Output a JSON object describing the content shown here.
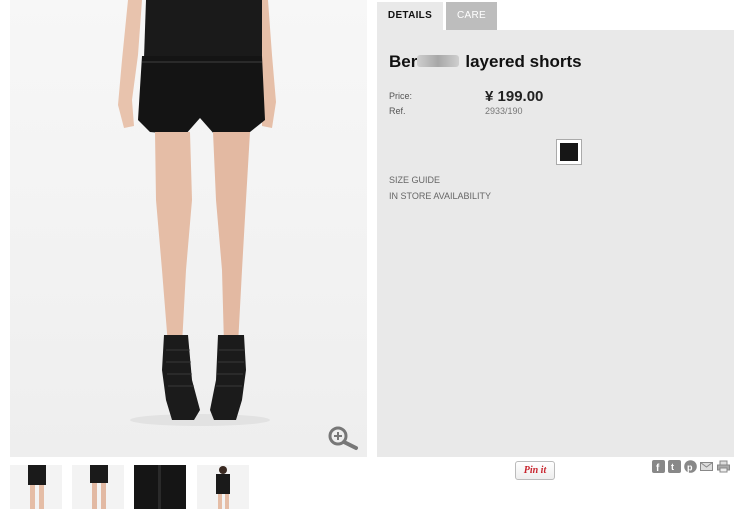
{
  "tabs": [
    {
      "label": "DETAILS",
      "active": true
    },
    {
      "label": "CARE",
      "active": false
    }
  ],
  "product": {
    "title_prefix": "Ber",
    "title_suffix": "layered shorts",
    "price_label": "Price:",
    "price_value": "¥ 199.00",
    "ref_label": "Ref.",
    "ref_value": "2933/190",
    "color_swatch": "black"
  },
  "links": {
    "size_guide": "SIZE GUIDE",
    "store_availability": "IN STORE AVAILABILITY"
  },
  "share": {
    "pinit_label": "Pin it",
    "icons": [
      "facebook-icon",
      "twitter-icon",
      "pinterest-icon",
      "email-icon",
      "print-icon"
    ]
  },
  "colors": {
    "panel_bg": "#e9e9e9",
    "inactive_tab_bg": "#bdbdbd",
    "pinit_red": "#c8232c"
  }
}
